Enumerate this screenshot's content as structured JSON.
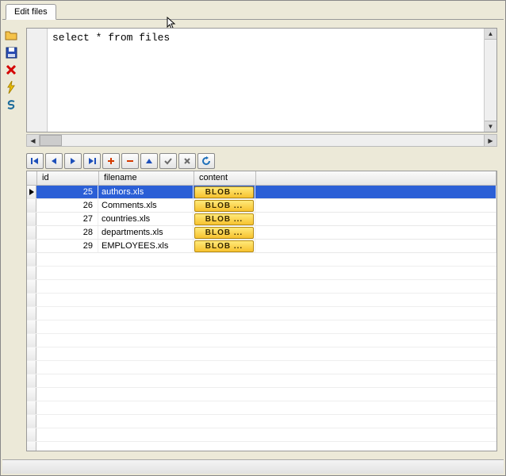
{
  "tab": {
    "label": "Edit files"
  },
  "sql": {
    "text": "select * from files"
  },
  "grid": {
    "headers": {
      "id": "id",
      "filename": "filename",
      "content": "content"
    },
    "blob_label": "BLOB ...",
    "rows": [
      {
        "id": "25",
        "filename": "authors.xls",
        "selected": true
      },
      {
        "id": "26",
        "filename": "Comments.xls",
        "selected": false
      },
      {
        "id": "27",
        "filename": "countries.xls",
        "selected": false
      },
      {
        "id": "28",
        "filename": "departments.xls",
        "selected": false
      },
      {
        "id": "29",
        "filename": "EMPLOYEES.xls",
        "selected": false
      }
    ]
  }
}
